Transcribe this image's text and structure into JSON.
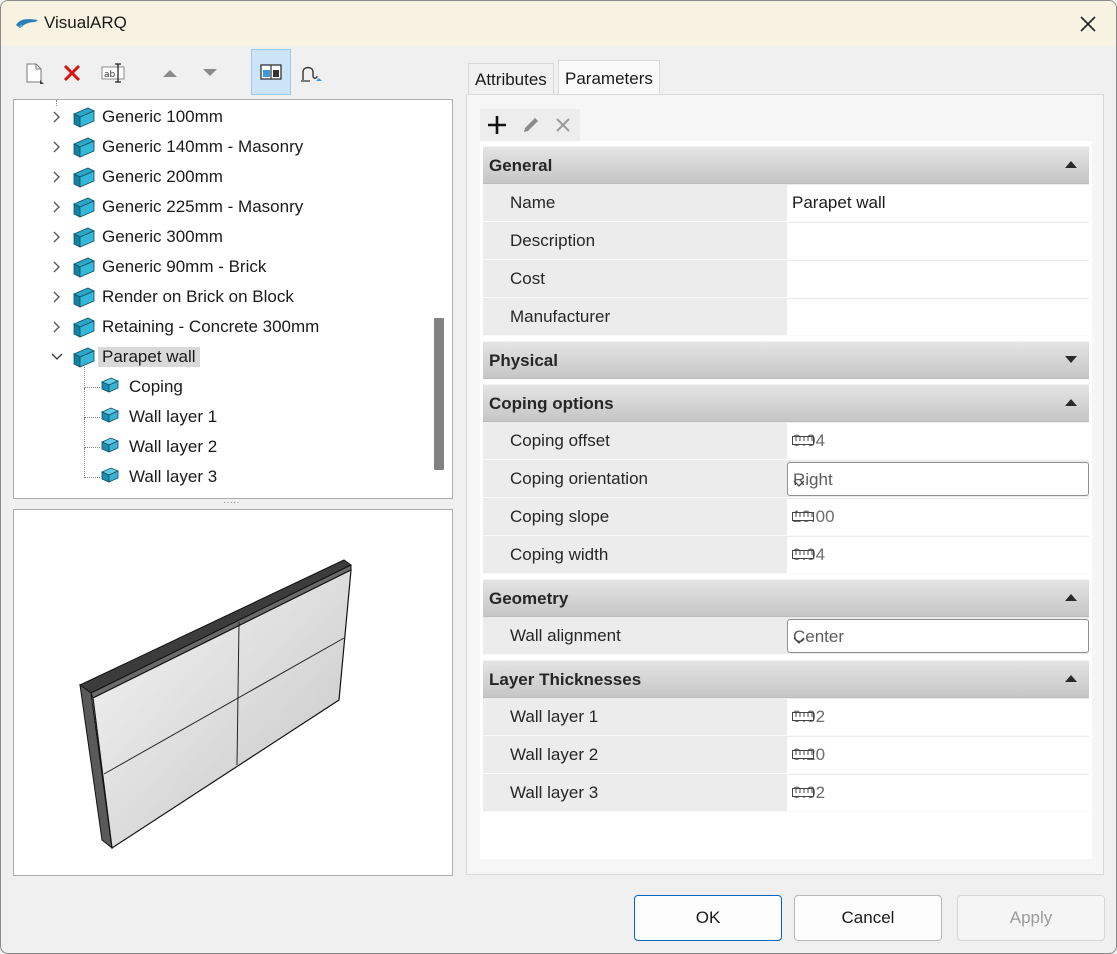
{
  "window": {
    "title": "VisualARQ"
  },
  "toolbar": {
    "icons": [
      "new-document-icon",
      "delete-icon",
      "rename-icon",
      "move-up-icon",
      "move-down-icon",
      "split-view-icon",
      "profile-icon"
    ]
  },
  "tree": {
    "items": [
      {
        "label": "Generic 100mm",
        "level": 0
      },
      {
        "label": "Generic 140mm - Masonry",
        "level": 0
      },
      {
        "label": "Generic 200mm",
        "level": 0
      },
      {
        "label": "Generic 225mm - Masonry",
        "level": 0
      },
      {
        "label": "Generic 300mm",
        "level": 0
      },
      {
        "label": "Generic 90mm - Brick",
        "level": 0
      },
      {
        "label": "Render on Brick on Block",
        "level": 0
      },
      {
        "label": "Retaining - Concrete 300mm",
        "level": 0
      },
      {
        "label": "Parapet wall",
        "level": 0,
        "expanded": true,
        "selected": true
      },
      {
        "label": "Coping",
        "level": 1
      },
      {
        "label": "Wall layer 1",
        "level": 1
      },
      {
        "label": "Wall layer 2",
        "level": 1
      },
      {
        "label": "Wall layer 3",
        "level": 1
      }
    ]
  },
  "tabs": [
    {
      "label": "Attributes",
      "active": false
    },
    {
      "label": "Parameters",
      "active": true
    }
  ],
  "sections": {
    "general": {
      "title": "General",
      "rows": [
        {
          "name": "Name",
          "value": "Parapet wall"
        },
        {
          "name": "Description",
          "value": ""
        },
        {
          "name": "Cost",
          "value": ""
        },
        {
          "name": "Manufacturer",
          "value": ""
        }
      ]
    },
    "physical": {
      "title": "Physical"
    },
    "coping": {
      "title": "Coping options",
      "rows": [
        {
          "name": "Coping offset",
          "value": "0.04"
        },
        {
          "name": "Coping orientation",
          "value": "Right"
        },
        {
          "name": "Coping slope",
          "value": "10.00"
        },
        {
          "name": "Coping width",
          "value": "0.04"
        }
      ]
    },
    "geometry": {
      "title": "Geometry",
      "rows": [
        {
          "name": "Wall alignment",
          "value": "Center"
        }
      ]
    },
    "layers": {
      "title": "Layer Thicknesses",
      "rows": [
        {
          "name": "Wall layer 1",
          "value": "0.02"
        },
        {
          "name": "Wall layer 2",
          "value": "0.20"
        },
        {
          "name": "Wall layer 3",
          "value": "0.02"
        }
      ]
    }
  },
  "buttons": {
    "ok": "OK",
    "cancel": "Cancel",
    "apply": "Apply"
  }
}
